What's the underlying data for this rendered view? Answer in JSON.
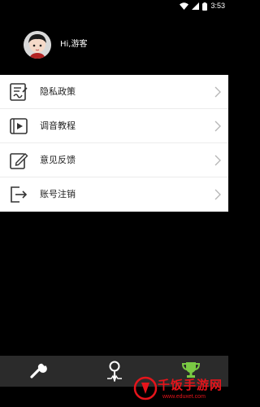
{
  "status_bar": {
    "time": "3:53",
    "icons": [
      "wifi-icon",
      "signal-icon",
      "battery-icon"
    ]
  },
  "profile": {
    "greeting": "Hi,游客",
    "avatar_icon": "user-avatar-icon"
  },
  "menu": {
    "items": [
      {
        "label": "隐私政策",
        "icon": "document-sign-icon"
      },
      {
        "label": "调音教程",
        "icon": "video-play-icon"
      },
      {
        "label": "意见反馈",
        "icon": "edit-pencil-icon"
      },
      {
        "label": "账号注销",
        "icon": "logout-icon"
      }
    ]
  },
  "tab_bar": {
    "tabs": [
      {
        "icon": "wrench-icon",
        "active": false
      },
      {
        "icon": "tuner-pin-icon",
        "active": false
      },
      {
        "icon": "trophy-icon",
        "active": true
      }
    ],
    "active_color": "#7ac943",
    "inactive_color": "#ffffff"
  },
  "watermark": {
    "title": "千饭手游网",
    "url": "www.eduxet.com",
    "color": "#e5141b"
  }
}
